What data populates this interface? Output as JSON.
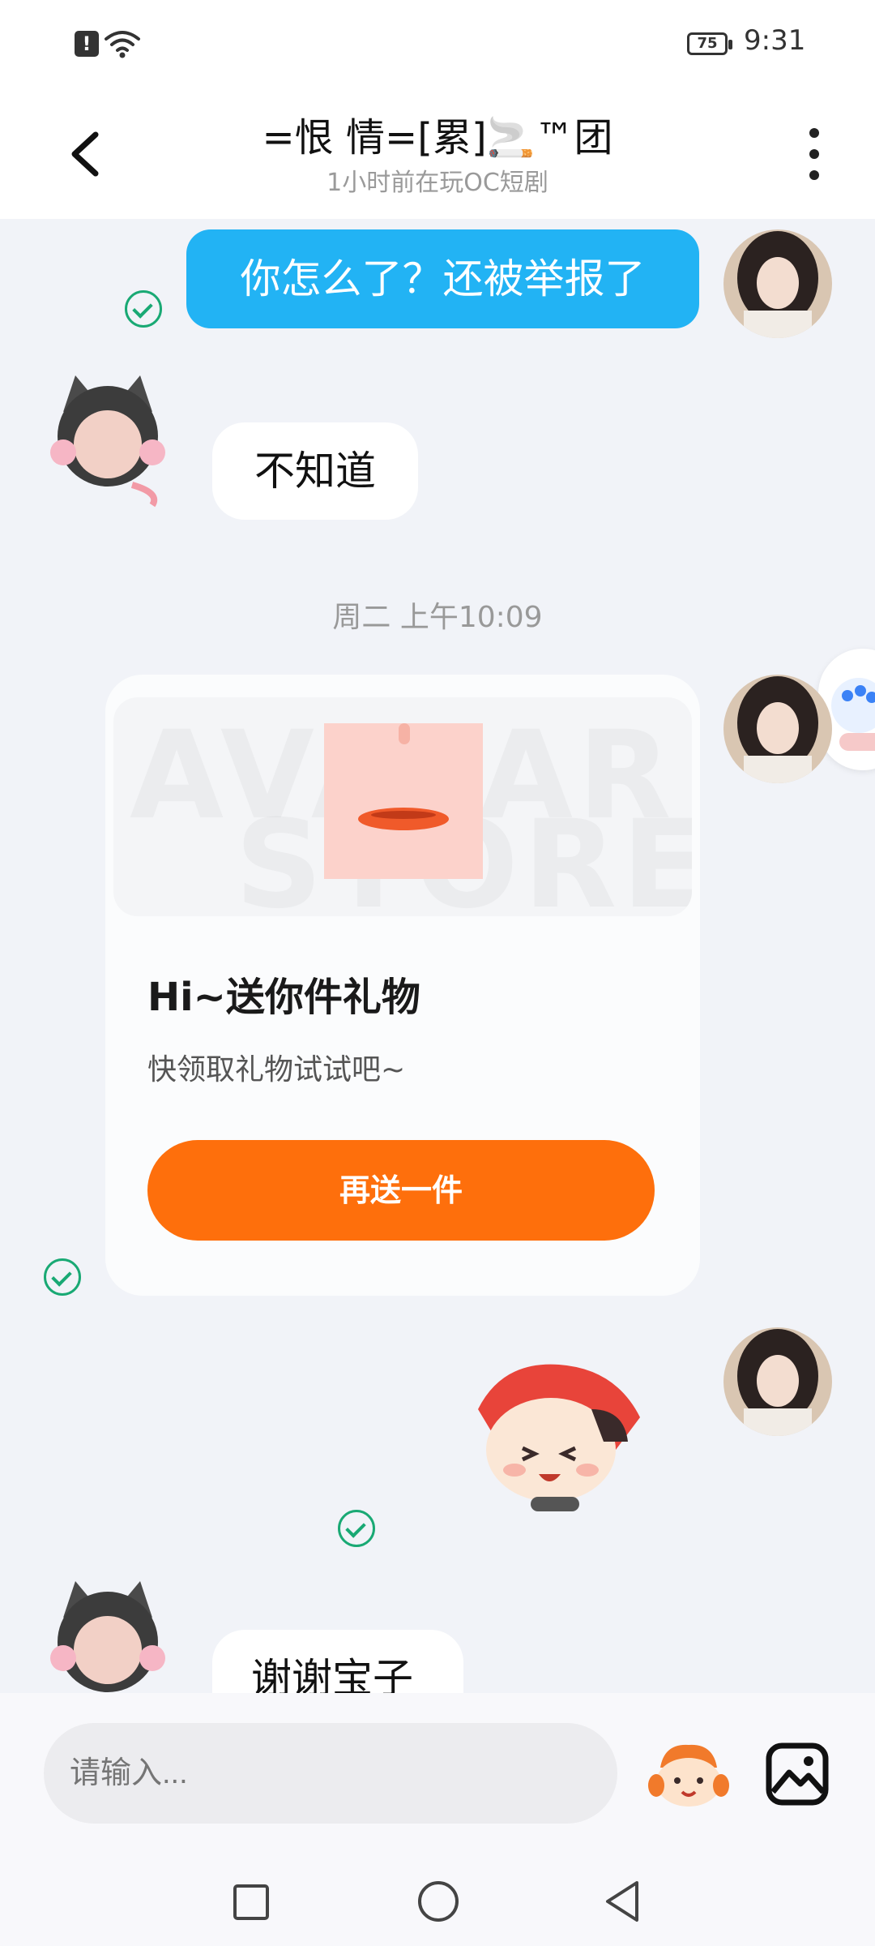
{
  "status": {
    "time": "9:31",
    "battery": "75"
  },
  "header": {
    "title": "=恨 情=[累]🚬™团",
    "subtitle": "1小时前在玩OC短剧"
  },
  "messages": {
    "m1": "你怎么了？还被举报了",
    "m2": "不知道",
    "timestamp": "周二 上午10:09",
    "m5": "谢谢宝子"
  },
  "gift": {
    "watermark_line1": "AVATAR",
    "watermark_line2": "STORE",
    "title": "Hi~送你件礼物",
    "description": "快领取礼物试试吧~",
    "button": "再送一件"
  },
  "composer": {
    "placeholder": "请输入..."
  },
  "colors": {
    "sent_bubble": "#22b3f4",
    "gift_button": "#fe6f0c",
    "read_check": "#19a974"
  }
}
